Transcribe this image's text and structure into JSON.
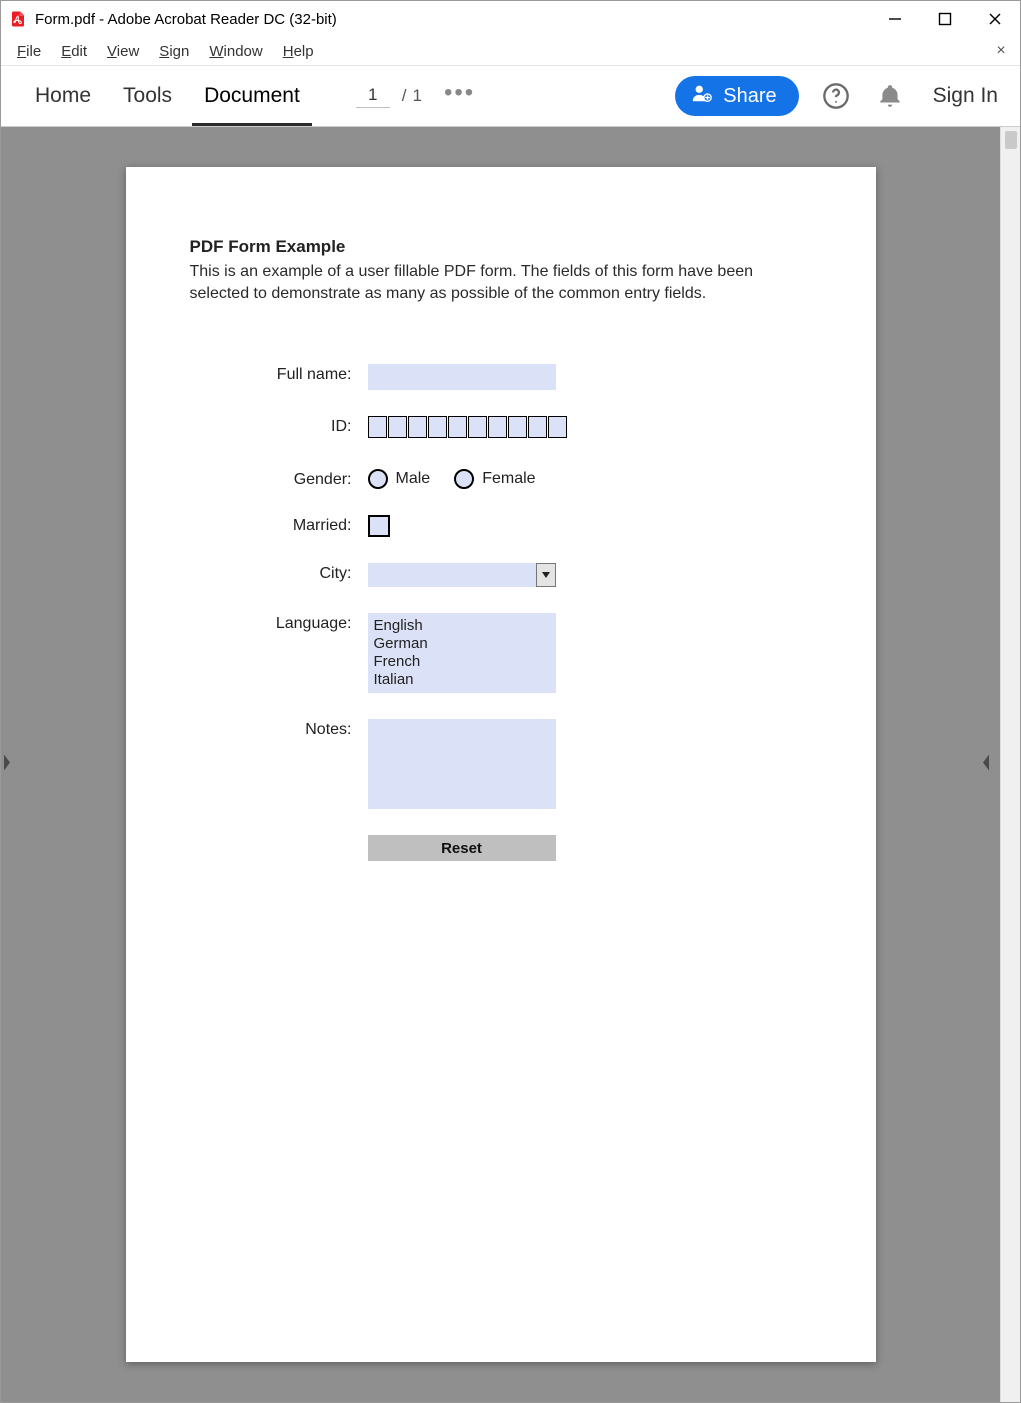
{
  "window": {
    "title": "Form.pdf - Adobe Acrobat Reader DC (32-bit)"
  },
  "menubar": {
    "file": "File",
    "edit": "Edit",
    "view": "View",
    "sign": "Sign",
    "window": "Window",
    "help": "Help"
  },
  "toolbar": {
    "home_tab": "Home",
    "tools_tab": "Tools",
    "document_tab": "Document",
    "current_page": "1",
    "page_sep": "/",
    "total_pages": "1",
    "share_label": "Share",
    "signin_label": "Sign In"
  },
  "doc": {
    "heading": "PDF Form Example",
    "description": "This is an example of a user fillable PDF form. The fields of this form have been selected to demonstrate as many as possible of the common entry fields.",
    "labels": {
      "fullname": "Full name:",
      "id": "ID:",
      "gender": "Gender:",
      "married": "Married:",
      "city": "City:",
      "language": "Language:",
      "notes": "Notes:"
    },
    "gender_options": {
      "male": "Male",
      "female": "Female"
    },
    "languages": [
      "English",
      "German",
      "French",
      "Italian"
    ],
    "reset_label": "Reset"
  }
}
